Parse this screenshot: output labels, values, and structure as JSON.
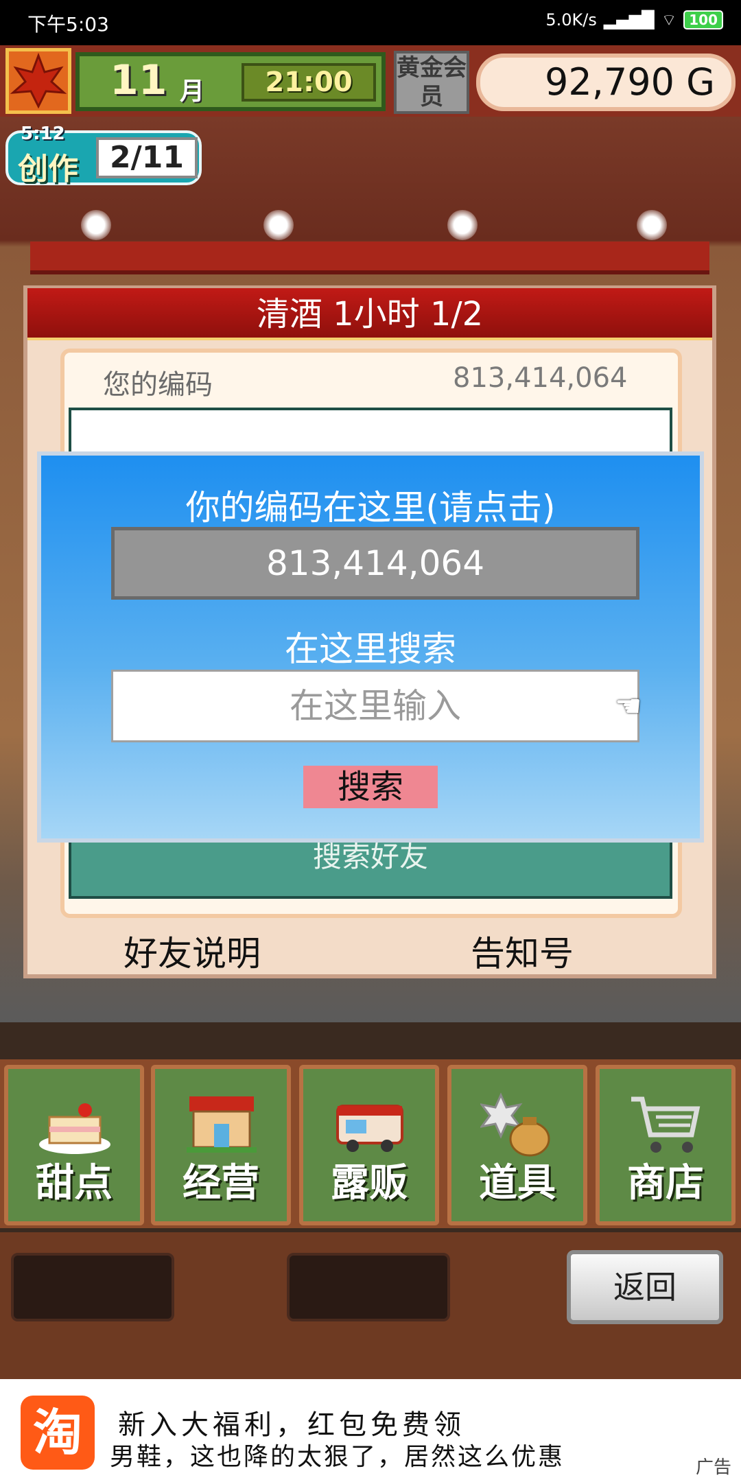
{
  "status_bar": {
    "time": "下午5:03",
    "net_speed": "5.0K/s",
    "battery": "100"
  },
  "hud": {
    "month_number": "11",
    "month_unit": "月",
    "clock": "21:00",
    "member_badge": "黄金会员",
    "money": "92,790 G"
  },
  "create_badge": {
    "timer": "5:12",
    "label": "创作",
    "progress": "2/11"
  },
  "panel": {
    "title": "清酒  1小时 1/2",
    "code_label": "您的编码",
    "code_value": "813,414,064",
    "search_friends_label": "搜索好友",
    "friend_help": "好友说明",
    "notify_number": "告知号"
  },
  "dialog": {
    "title": "你的编码在这里(请点击)",
    "code": "813,414,064",
    "search_label": "在这里搜索",
    "input_placeholder": "在这里输入",
    "search_button": "搜索"
  },
  "menu": {
    "items": [
      {
        "label": "甜点",
        "icon": "cake-icon"
      },
      {
        "label": "经营",
        "icon": "shop-icon"
      },
      {
        "label": "露贩",
        "icon": "food-truck-icon"
      },
      {
        "label": "道具",
        "icon": "item-bag-icon"
      },
      {
        "label": "商店",
        "icon": "shopping-cart-icon"
      }
    ]
  },
  "back_button": "返回",
  "ad": {
    "logo_char": "淘",
    "line1": "新入大福利，红包免费领",
    "line2": "男鞋，这也降的太狠了，居然这么优惠",
    "tag": "广告"
  },
  "colors": {
    "dialog_top": "#1e8ff0",
    "panel_header": "#c11a16",
    "menu_green": "#5e8a46",
    "search_button": "#ef8792"
  }
}
